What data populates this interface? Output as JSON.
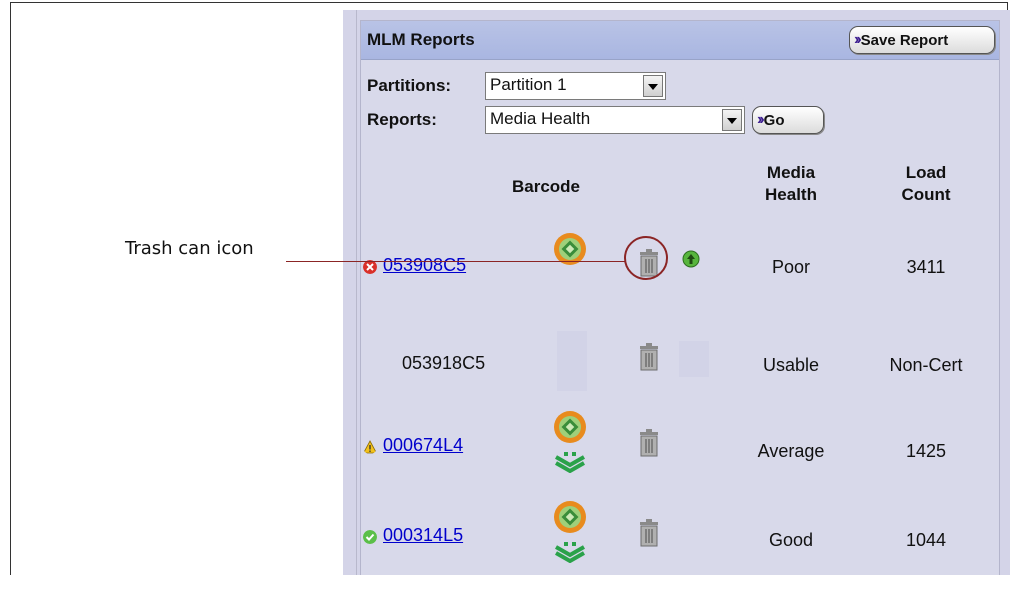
{
  "callout": {
    "label": "Trash can icon"
  },
  "panel": {
    "title": "MLM Reports",
    "save_label": "Save Report"
  },
  "filters": {
    "partitions_label": "Partitions:",
    "partition_value": "Partition 1",
    "reports_label": "Reports:",
    "report_value": "Media Health",
    "go_label": "Go"
  },
  "table": {
    "col_barcode": "Barcode",
    "col_health_1": "Media",
    "col_health_2": "Health",
    "col_count_1": "Load",
    "col_count_2": "Count",
    "rows": [
      {
        "barcode": "053908C5",
        "status": "error",
        "health": "Poor",
        "count": "3411",
        "linked": true
      },
      {
        "barcode": "053918C5",
        "status": "none",
        "health": "Usable",
        "count": "Non-Cert",
        "linked": false
      },
      {
        "barcode": "000674L4",
        "status": "warning",
        "health": "Average",
        "count": "1425",
        "linked": true
      },
      {
        "barcode": "000314L5",
        "status": "good",
        "health": "Good",
        "count": "1044",
        "linked": true
      }
    ]
  },
  "colors": {
    "accent_callout": "#8b2525",
    "link": "#0000cc",
    "header_bg": "#aab6e1"
  }
}
